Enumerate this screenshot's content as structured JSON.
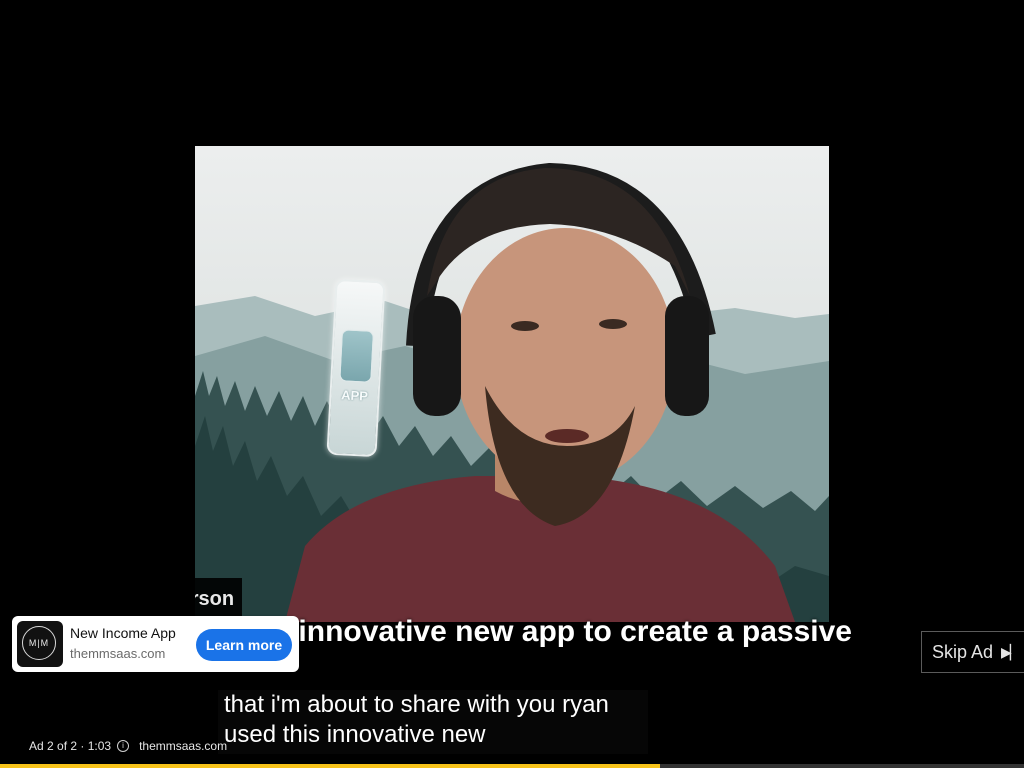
{
  "video": {
    "presenter_name": "Ryan Peterson",
    "burned_caption": "Ryan uses innovative new app to create a passive",
    "app_label": "APP"
  },
  "ad_card": {
    "logo_text": "M|M",
    "title": "New Income App",
    "domain": "themmsaas.com",
    "cta_label": "Learn more",
    "cta_color": "#1a73e8"
  },
  "skip": {
    "label": "Skip Ad",
    "icon": "skip-next-icon"
  },
  "captions": {
    "line1": "that i'm about to share with you ryan",
    "line2": "used this innovative new"
  },
  "ad_status": {
    "position": "Ad 2 of 2 · 1:03",
    "info_icon": "info-icon",
    "url": "themmsaas.com"
  },
  "progress": {
    "fraction": 0.645,
    "color": "#f7c31a"
  }
}
